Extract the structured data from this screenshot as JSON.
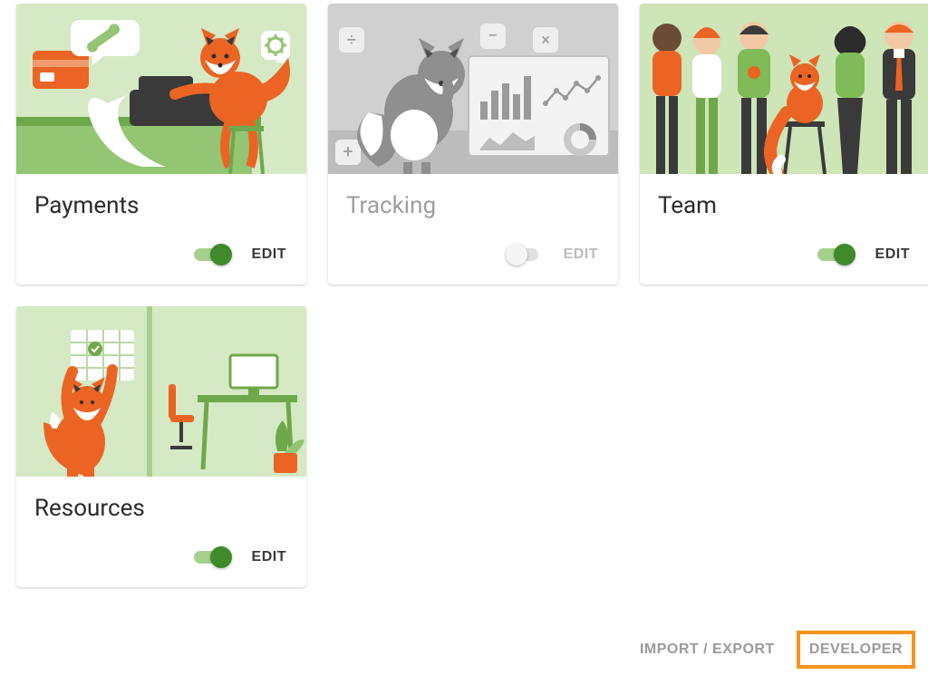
{
  "cards": [
    {
      "title": "Payments",
      "enabled": true,
      "edit_label": "EDIT"
    },
    {
      "title": "Tracking",
      "enabled": false,
      "edit_label": "EDIT"
    },
    {
      "title": "Team",
      "enabled": true,
      "edit_label": "EDIT"
    },
    {
      "title": "Resources",
      "enabled": true,
      "edit_label": "EDIT"
    }
  ],
  "footer": {
    "import_export_label": "IMPORT / EXPORT",
    "developer_label": "DEVELOPER"
  },
  "colors": {
    "accent_green": "#3f8a2a",
    "highlight_orange": "#f7941d",
    "orange_fox": "#eb6424",
    "light_green": "#cde5b7"
  }
}
